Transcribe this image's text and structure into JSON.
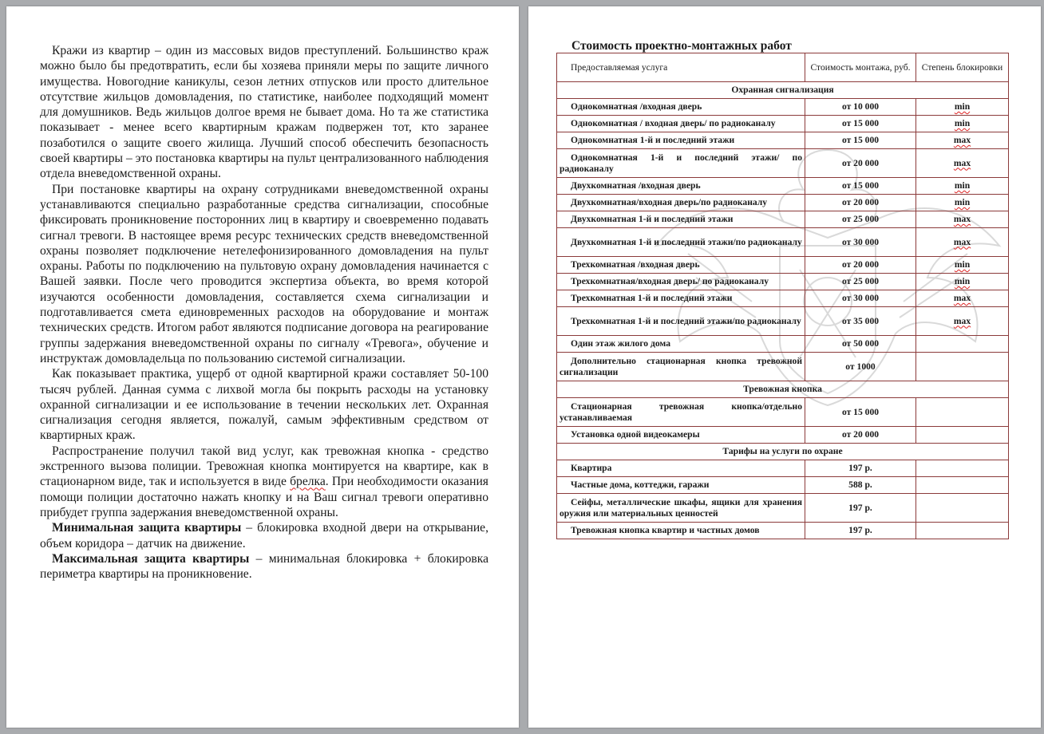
{
  "left_page": {
    "paragraphs": [
      {
        "text": "Кражи из квартир – один из массовых видов преступлений. Большинство краж можно было бы предотвратить, если бы хозяева приняли меры по защите личного имущества. Новогодние каникулы, сезон летних отпусков или просто длительное отсутствие жильцов домовладения, по статистике, наиболее подходящий момент для домушников. Ведь жильцов долгое время не бывает дома. Но та же статистика показывает - менее всего квартирным кражам подвержен тот, кто заранее позаботился о защите своего жилища. Лучший способ обеспечить безопасность своей квартиры – это постановка квартиры на пульт централизованного наблюдения отдела вневедомственной охраны."
      },
      {
        "text": "При постановке квартиры на охрану сотрудниками вневедомственной охраны устанавливаются специально разработанные средства сигнализации, способные фиксировать проникновение посторонних лиц в квартиру и своевременно подавать сигнал тревоги. В настоящее время ресурс технических средств вневедомственной охраны позволяет подключение нетелефонизированного домовладения на пульт охраны. Работы по подключению на пультовую охрану домовладения начинается с Вашей заявки. После чего проводится экспертиза объекта, во время которой изучаются особенности домовладения, составляется схема сигнализации и подготавливается смета единовременных расходов на оборудование и монтаж технических средств. Итогом работ являются подписание договора на реагирование группы задержания вневедомственной охраны по сигналу «Тревога», обучение и инструктаж домовладельца по пользованию системой сигнализации."
      },
      {
        "text": "Как показывает практика, ущерб от одной квартирной кражи составляет 50-100 тысяч рублей. Данная сумма с лихвой могла бы покрыть расходы на установку охранной сигнализации и ее использование в течении нескольких лет. Охранная сигнализация сегодня является, пожалуй, самым эффективным средством от квартирных краж."
      },
      {
        "pre": "Распространение получил такой вид услуг, как тревожная кнопка - средство экстренного вызова полиции. Тревожная кнопка монтируется на квартире, как в стационарном виде, так и используется в виде ",
        "squig": "брелка",
        "post": ". При необходимости оказания помощи полиции достаточно нажать кнопку и на Ваш сигнал тревоги оперативно прибудет группа задержания вневедомственной охраны."
      },
      {
        "bold": "Минимальная защита квартиры",
        "text": " – блокировка входной двери на открывание, объем коридора – датчик на движение."
      },
      {
        "bold": "Максимальная защита квартиры",
        "text": " – минимальная блокировка + блокировка периметра квартиры на проникновение."
      }
    ]
  },
  "right_page": {
    "title": "Стоимость проектно-монтажных работ",
    "headers": {
      "service": "Предоставляемая услуга",
      "cost": "Стоимость монтажа, руб.",
      "level": "Степень блокировки"
    },
    "sections": [
      {
        "title": "Охранная сигнализация",
        "rows": [
          {
            "service": "Однокомнатная /входная дверь",
            "cost": "от 10 000",
            "level": "min"
          },
          {
            "service": "Однокомнатная / входная дверь/ по радиоканалу",
            "cost": "от 15 000",
            "level": "min"
          },
          {
            "service": "Однокомнатная 1-й и последний этажи",
            "cost": "от 15 000",
            "level": "max"
          },
          {
            "service": "Однокомнатная 1-й и последний этажи/ по радиоканалу",
            "cost": "от 20 000",
            "level": "max"
          },
          {
            "service": "Двухкомнатная /входная дверь",
            "cost": "от 15 000",
            "level": "min"
          },
          {
            "service": "Двухкомнатная/входная дверь/по радиоканалу",
            "cost": "от 20 000",
            "level": "min"
          },
          {
            "service": "Двухкомнатная 1-й и последний этажи",
            "cost": "от 25 000",
            "level": "max"
          },
          {
            "service": "Двухкомнатная 1-й и последний этажи/по радиоканалу",
            "cost": "от 30 000",
            "level": "max"
          },
          {
            "service": "Трехкомнатная /входная дверь",
            "cost": "от 20 000",
            "level": "min"
          },
          {
            "service": "Трехкомнатная/входная дверь/ по радиоканалу",
            "cost": "от 25 000",
            "level": "min"
          },
          {
            "service": "Трехкомнатная 1-й и последний этажи",
            "cost": "от 30 000",
            "level": "max"
          },
          {
            "service": "Трехкомнатная 1-й и последний этажи/по радиоканалу",
            "cost": "от 35 000",
            "level": "max"
          },
          {
            "service": "Один этаж жилого дома",
            "cost": "от 50 000",
            "level": ""
          },
          {
            "service": "Дополнительно стационарная кнопка тревожной сигнализации",
            "cost": "от 1000",
            "level": ""
          }
        ]
      },
      {
        "title": "Тревожная кнопка",
        "rows": [
          {
            "service": "Стационарная тревожная кнопка/отдельно устанавливаемая",
            "cost": "от 15 000",
            "level": ""
          },
          {
            "service": "Установка одной видеокамеры",
            "cost": "от 20 000",
            "level": ""
          }
        ]
      },
      {
        "title": "Тарифы на услуги по охране",
        "rows": [
          {
            "service": "Квартира",
            "cost": "197 р.",
            "level": ""
          },
          {
            "service": "Частные дома, коттеджи, гаражи",
            "cost": "588 р.",
            "level": ""
          },
          {
            "service": "Сейфы, металлические шкафы, ящики для хранения оружия или материальных ценностей",
            "cost": "197 р.",
            "level": ""
          },
          {
            "service": "Тревожная кнопка квартир и частных домов",
            "cost": "197 р.",
            "level": ""
          }
        ]
      }
    ]
  },
  "colors": {
    "background": "#a9abae",
    "page": "#ffffff",
    "table_border": "#8b3a3a",
    "spell_red": "#dd2222",
    "spell_green": "#2a8a2a"
  }
}
